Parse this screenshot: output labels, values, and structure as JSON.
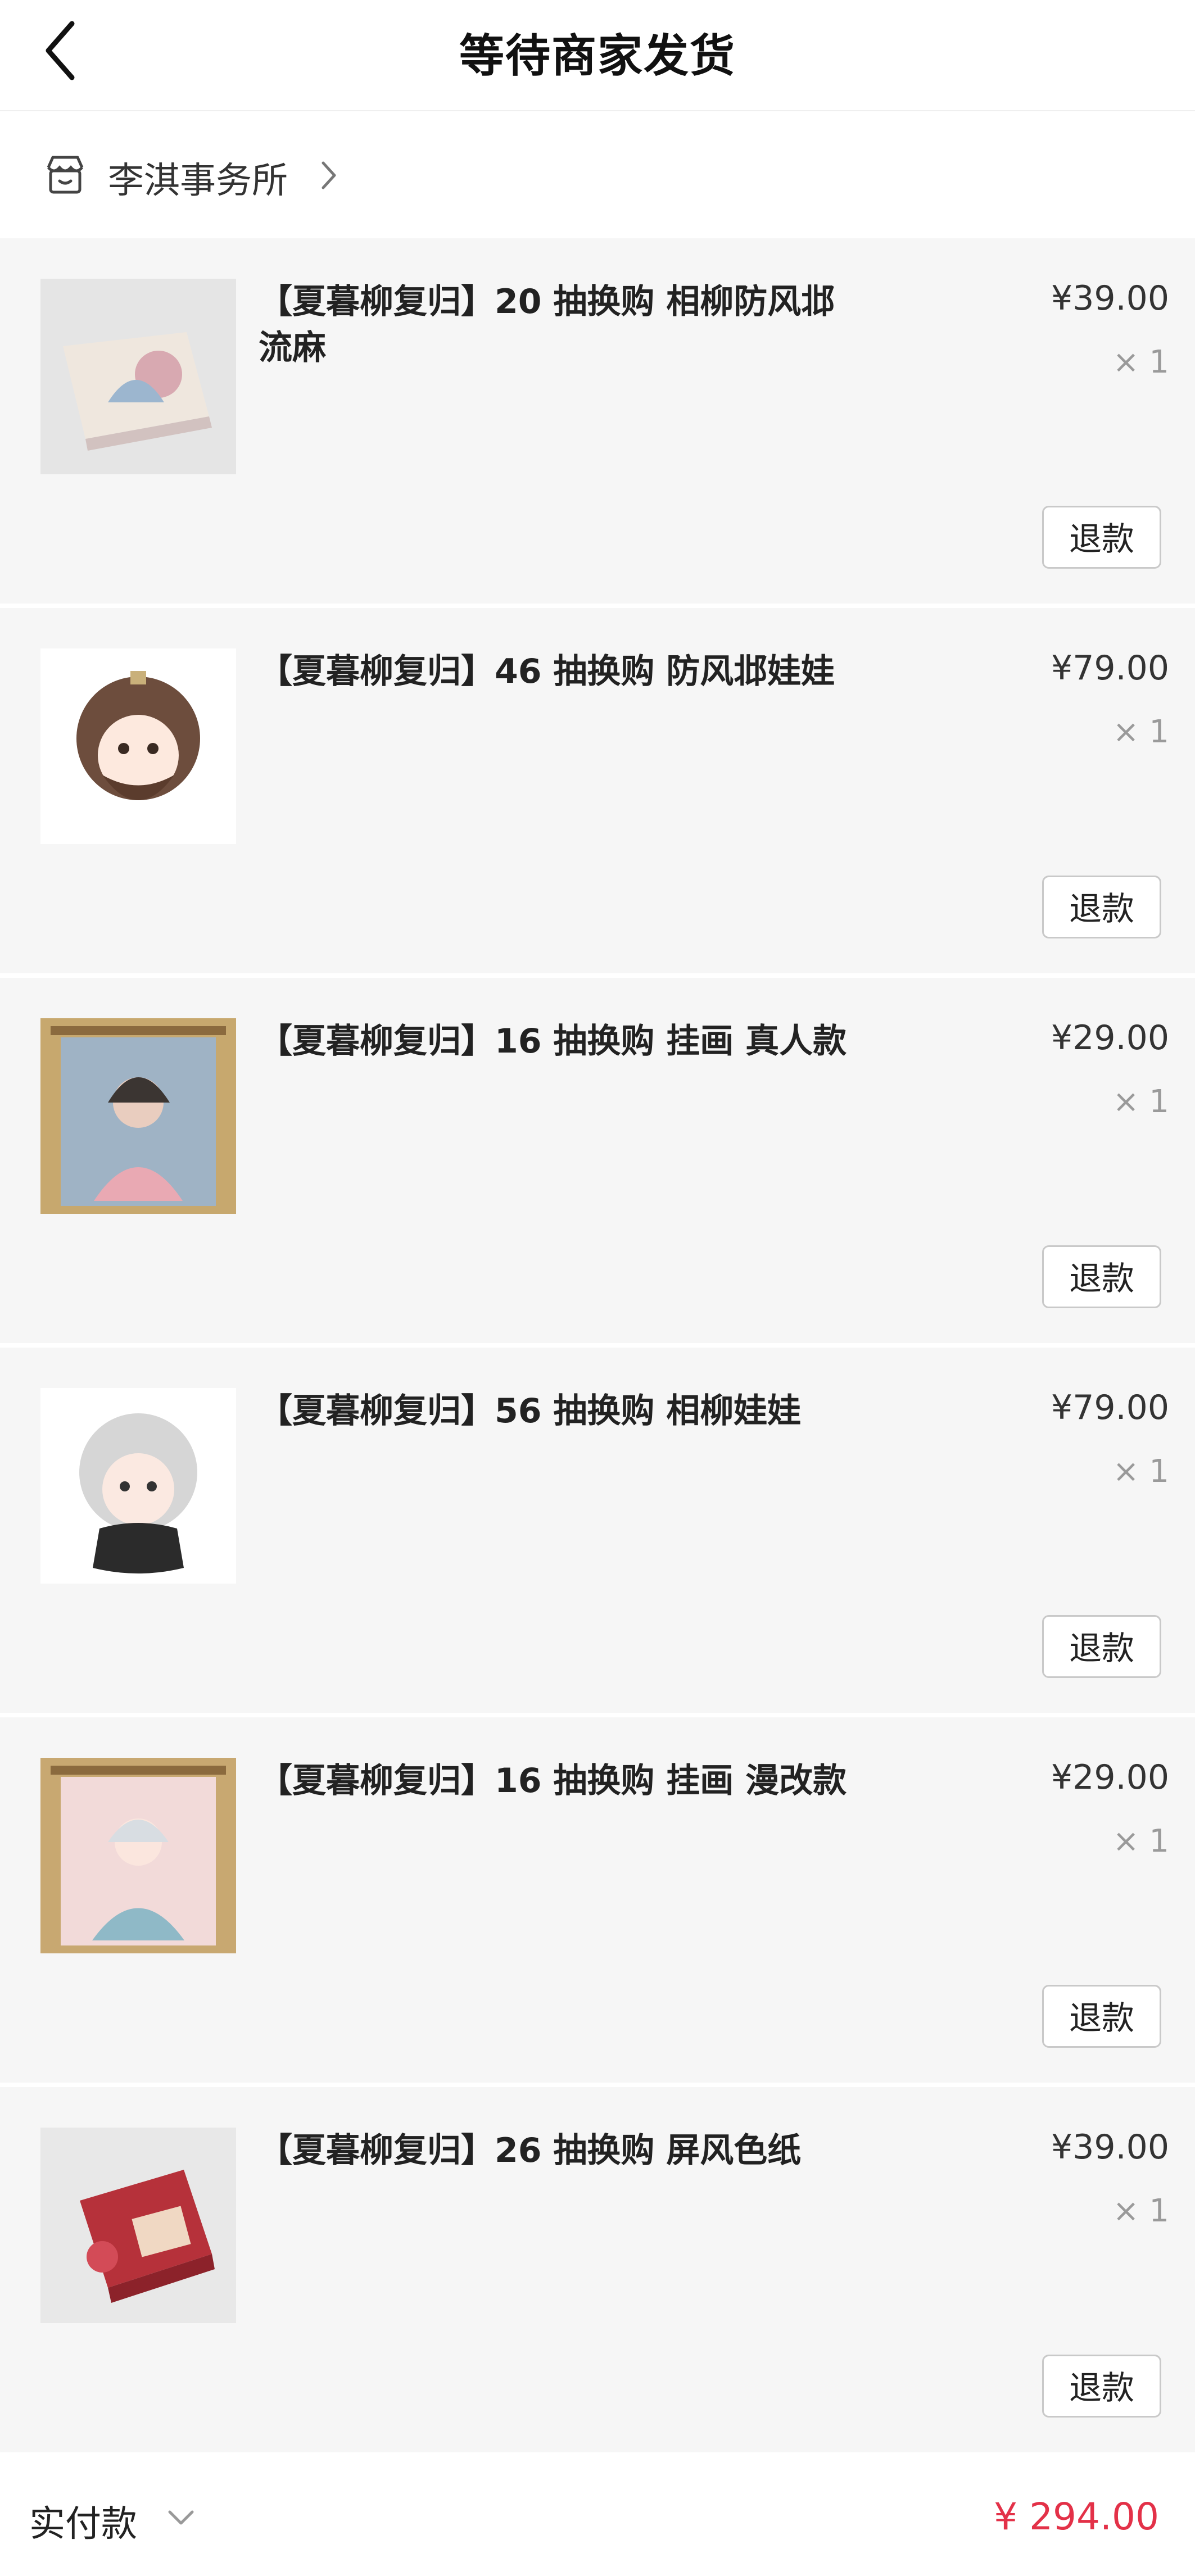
{
  "header": {
    "title": "等待商家发货",
    "back_icon": "back-chevron-icon"
  },
  "shop": {
    "icon": "shop-icon",
    "name": "李淇事务所",
    "chevron_icon": "chevron-right-icon"
  },
  "items": [
    {
      "title": "【夏暮柳复归】20 抽换购 相柳防风邶流麻",
      "price": "¥39.00",
      "qty": "× 1",
      "refund_label": "退款"
    },
    {
      "title": "【夏暮柳复归】46 抽换购 防风邶娃娃",
      "price": "¥79.00",
      "qty": "× 1",
      "refund_label": "退款"
    },
    {
      "title": "【夏暮柳复归】16 抽换购 挂画 真人款",
      "price": "¥29.00",
      "qty": "× 1",
      "refund_label": "退款"
    },
    {
      "title": "【夏暮柳复归】56 抽换购 相柳娃娃",
      "price": "¥79.00",
      "qty": "× 1",
      "refund_label": "退款"
    },
    {
      "title": "【夏暮柳复归】16 抽换购 挂画 漫改款",
      "price": "¥29.00",
      "qty": "× 1",
      "refund_label": "退款"
    },
    {
      "title": "【夏暮柳复归】26 抽换购 屏风色纸",
      "price": "¥39.00",
      "qty": "× 1",
      "refund_label": "退款"
    }
  ],
  "footer": {
    "label": "实付款",
    "chevron_icon": "chevron-down-icon",
    "total": "¥ 294.00"
  },
  "colors": {
    "accent_total": "#e33148",
    "card_bg": "#f6f6f6"
  }
}
